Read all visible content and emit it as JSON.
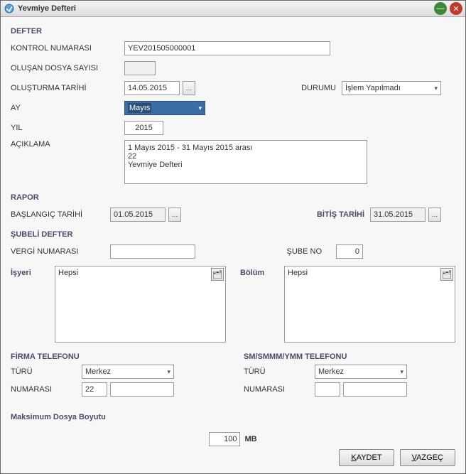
{
  "window": {
    "title": "Yevmiye Defteri"
  },
  "sections": {
    "defter": "DEFTER",
    "rapor": "RAPOR",
    "subeli": "ŞUBELİ DEFTER",
    "firmaTel": "FİRMA TELEFONU",
    "smTel": "SM/SMMM/YMM TELEFONU"
  },
  "labels": {
    "kontrolNumarasi": "KONTROL NUMARASI",
    "olusanDosyaSayisi": "OLUŞAN DOSYA SAYISI",
    "olusturmaTarihi": "OLUŞTURMA TARİHİ",
    "durumu": "DURUMU",
    "ay": "AY",
    "yil": "YIL",
    "aciklama": "AÇIKLAMA",
    "baslangicTarihi": "BAŞLANGIÇ TARİHİ",
    "bitisTarihi": "BİTİŞ TARİHİ",
    "vergiNumarasi": "VERGİ NUMARASI",
    "subeNo": "ŞUBE NO",
    "isyeri": "İşyeri",
    "bolum": "Bölüm",
    "turu": "TÜRÜ",
    "numarasi": "NUMARASI",
    "maksDosya": "Maksimum Dosya Boyutu",
    "mb": "MB"
  },
  "values": {
    "kontrolNumarasi": "YEV201505000001",
    "olusanDosyaSayisi": "",
    "olusturmaTarihi": "14.05.2015",
    "durumu": "İşlem Yapılmadı",
    "ay": "Mayıs",
    "yil": "2015",
    "aciklama": "1 Mayıs 2015 - 31 Mayıs 2015 arası\n22\nYevmiye Defteri",
    "baslangicTarihi": "01.05.2015",
    "bitisTarihi": "31.05.2015",
    "vergiNumarasi": "",
    "subeNo": "0",
    "isyeriList": "Hepsi",
    "bolumList": "Hepsi",
    "firmaTuru": "Merkez",
    "firmaNumarasiArea": "22",
    "firmaNumarasi": "",
    "smTuru": "Merkez",
    "smNumarasiArea": "",
    "smNumarasi": "",
    "maksDosya": "100"
  },
  "buttons": {
    "save": "KAYDET",
    "saveUL": "K",
    "cancel": "VAZGEÇ",
    "cancelUL": "V"
  },
  "icons": {
    "dots": "…",
    "chevDown": "▾",
    "minimize": "—",
    "close": "✕",
    "search": "🗂"
  }
}
